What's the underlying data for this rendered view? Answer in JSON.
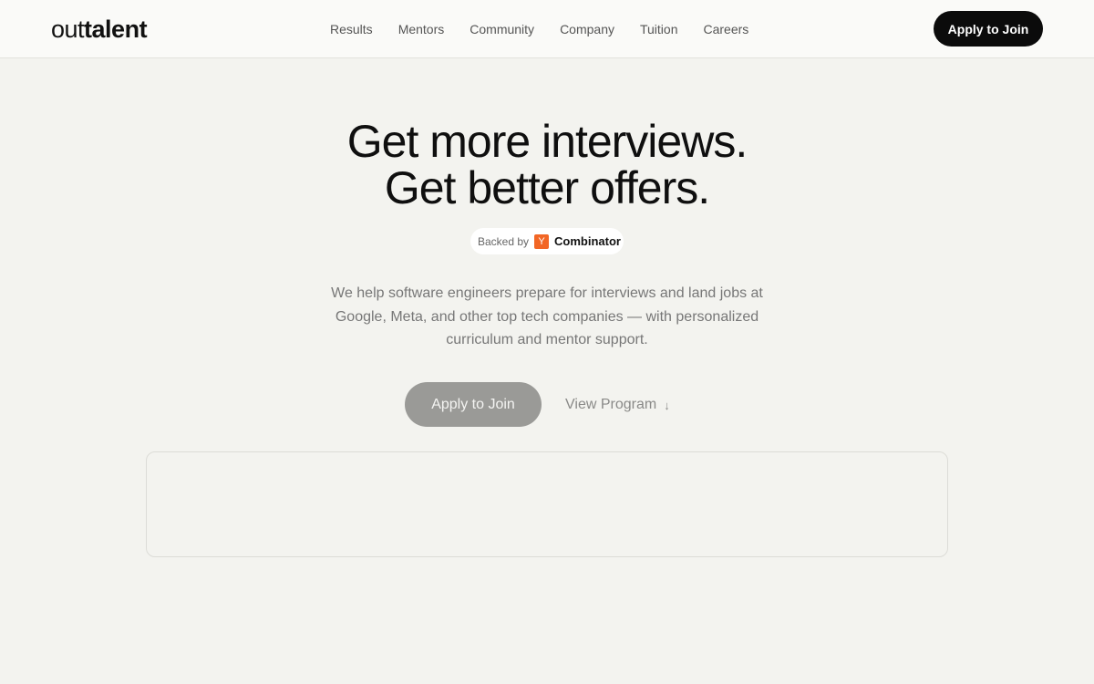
{
  "header": {
    "logo_light": "out",
    "logo_bold": "talent",
    "nav": [
      "Results",
      "Mentors",
      "Community",
      "Company",
      "Tuition",
      "Careers"
    ],
    "cta_label": "Apply to Join"
  },
  "hero": {
    "title_line1": "Get more interviews.",
    "title_line2": "Get better offers.",
    "badge": {
      "prefix": "Backed by",
      "icon_letter": "Y",
      "name": "Combinator"
    },
    "subtitle": "We help software engineers prepare for interviews and land jobs at Google, Meta, and other top tech companies — with personalized curriculum and mentor support.",
    "primary_cta": "Apply to Join",
    "secondary_cta": "View Program",
    "secondary_icon": "arrow-down-icon"
  },
  "colors": {
    "background": "#f3f3ef",
    "cta_dark": "#0b0b0b",
    "cta_muted": "#9a9a97",
    "yc_orange": "#f26625"
  }
}
